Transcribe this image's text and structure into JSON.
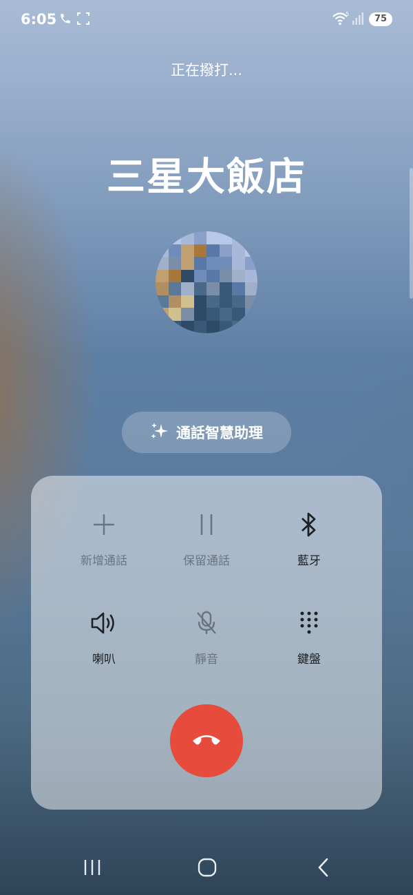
{
  "status_bar": {
    "time": "6:05",
    "battery": "75",
    "icons": [
      "phone-call-icon",
      "screenshot-frame-icon",
      "wifi-5g-icon",
      "signal-icon",
      "battery-icon"
    ]
  },
  "call": {
    "status": "正在撥打...",
    "contact_name": "三星大飯店"
  },
  "assistant": {
    "label": "通話智慧助理",
    "icon": "sparkle-icon"
  },
  "controls": [
    {
      "label": "新增通話",
      "icon": "plus-icon",
      "enabled": false
    },
    {
      "label": "保留通話",
      "icon": "pause-icon",
      "enabled": false
    },
    {
      "label": "藍牙",
      "icon": "bluetooth-icon",
      "enabled": true
    },
    {
      "label": "喇叭",
      "icon": "speaker-icon",
      "enabled": true
    },
    {
      "label": "靜音",
      "icon": "mic-off-icon",
      "enabled": false
    },
    {
      "label": "鍵盤",
      "icon": "keypad-icon",
      "enabled": true
    }
  ],
  "end_call": {
    "icon": "end-call-icon",
    "color": "#e64b3b"
  },
  "nav_bar": {
    "icons": [
      "recent-apps-icon",
      "home-icon",
      "back-icon"
    ]
  }
}
